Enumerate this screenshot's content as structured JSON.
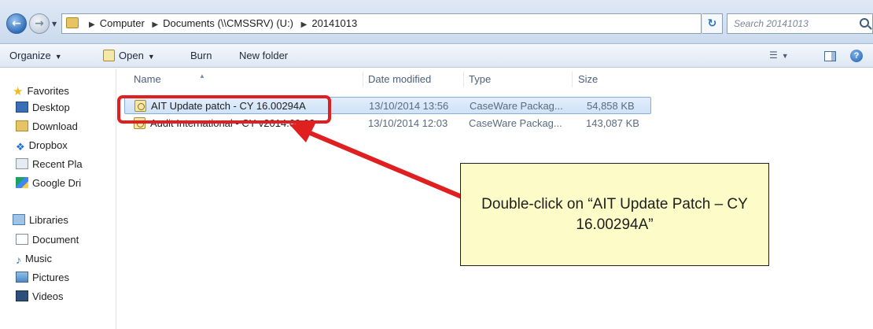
{
  "address_bar": {
    "breadcrumbs": [
      "Computer",
      "Documents (\\\\CMSSRV) (U:)",
      "20141013"
    ],
    "search_placeholder": "Search 20141013"
  },
  "toolbar": {
    "organize_label": "Organize",
    "open_label": "Open",
    "burn_label": "Burn",
    "new_folder_label": "New folder"
  },
  "nav_pane": {
    "favorites_label": "Favorites",
    "favorites": [
      {
        "label": "Desktop",
        "icon": "desktop-icon"
      },
      {
        "label": "Download",
        "icon": "downloads-folder-icon"
      },
      {
        "label": "Dropbox",
        "icon": "dropbox-icon"
      },
      {
        "label": "Recent Pla",
        "icon": "recent-places-icon"
      },
      {
        "label": "Google Dri",
        "icon": "google-drive-icon"
      }
    ],
    "libraries_label": "Libraries",
    "libraries": [
      {
        "label": "Document",
        "icon": "documents-icon"
      },
      {
        "label": "Music",
        "icon": "music-icon"
      },
      {
        "label": "Pictures",
        "icon": "pictures-icon"
      },
      {
        "label": "Videos",
        "icon": "videos-icon"
      }
    ]
  },
  "file_list": {
    "columns": [
      "Name",
      "Date modified",
      "Type",
      "Size"
    ],
    "rows": [
      {
        "name": "AIT Update patch - CY 16.00294A",
        "date_modified": "13/10/2014 13:56",
        "type": "CaseWare Packag...",
        "size": "54,858 KB",
        "selected": true
      },
      {
        "name": "Audit International - CY v2014.09.03",
        "date_modified": "13/10/2014 12:03",
        "type": "CaseWare Packag...",
        "size": "143,087 KB",
        "selected": false
      }
    ]
  },
  "annotation": {
    "callout_text": "Double-click on “AIT Update Patch – CY 16.00294A”",
    "highlight_color": "#e02020",
    "callout_color": "#fdfbc8"
  }
}
